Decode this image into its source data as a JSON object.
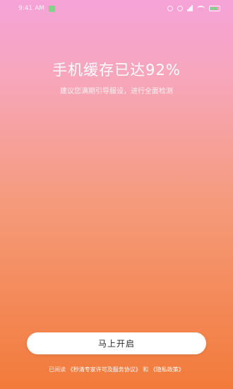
{
  "status_bar": {
    "time_text": "9:41 AM",
    "battery_color": "#7dd48a"
  },
  "main": {
    "headline": "手机缓存已达92%",
    "subtitle": "建议您满期引导服设，进行全面检测"
  },
  "action": {
    "button_label": "马上开启"
  },
  "agreement": {
    "prefix": "已阅读",
    "service_link": "《秒清专家许可及服务协议》",
    "and": "和",
    "privacy_link": "《隐私政策》"
  },
  "colors": {
    "gradient_top": "#f5a3d8",
    "gradient_mid": "#f59b7c",
    "gradient_bottom": "#f27a3a",
    "button_bg": "#ffffff"
  }
}
